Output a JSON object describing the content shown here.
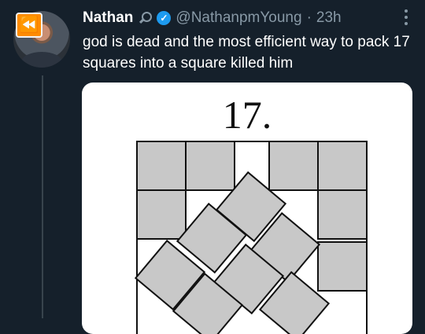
{
  "tweet": {
    "author_name": "Nathan",
    "handle": "@NathanpmYoung",
    "separator": "·",
    "time": "23h",
    "text": "god is dead and the most efficient way to pack 17 squares into a square killed him"
  },
  "media": {
    "title": "17."
  },
  "icons": {
    "avatar": "user-avatar",
    "rewind": "rewind-icon",
    "search": "magnifying-glass-icon",
    "verified": "verified-badge-icon",
    "more": "more-options-icon"
  },
  "colors": {
    "background": "#15202b",
    "verified": "#1d9bf0",
    "square_fill": "#c8c8c8",
    "rewind_badge": "#ff8c00"
  }
}
